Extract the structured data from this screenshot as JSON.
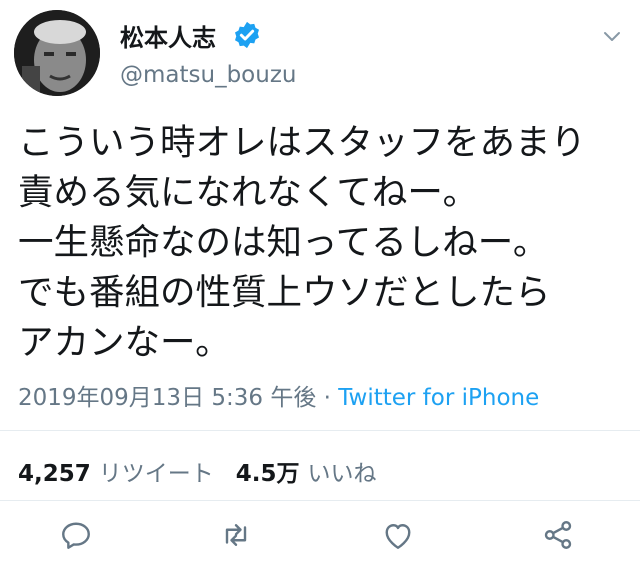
{
  "user": {
    "display_name": "松本人志",
    "handle": "@matsu_bouzu",
    "verified_icon": "verified-badge-icon"
  },
  "tweet": {
    "text": "こういう時オレはスタッフをあまり\n責める気になれなくてねー。\n一生懸命なのは知ってるしねー。\nでも番組の性質上ウソだとしたら\nアカンなー。",
    "timestamp": "2019年09月13日 5:36 午後",
    "separator": " · ",
    "source": "Twitter for iPhone"
  },
  "stats": {
    "retweets_count": "4,257",
    "retweets_label": "リツイート",
    "likes_count": "4.5万",
    "likes_label": "いいね"
  },
  "actions": [
    "reply-icon",
    "retweet-icon",
    "like-icon",
    "share-icon"
  ],
  "colors": {
    "text": "#14171a",
    "secondary": "#657786",
    "link": "#1da1f2",
    "divider": "#e6ecf0",
    "verified": "#1da1f2"
  }
}
